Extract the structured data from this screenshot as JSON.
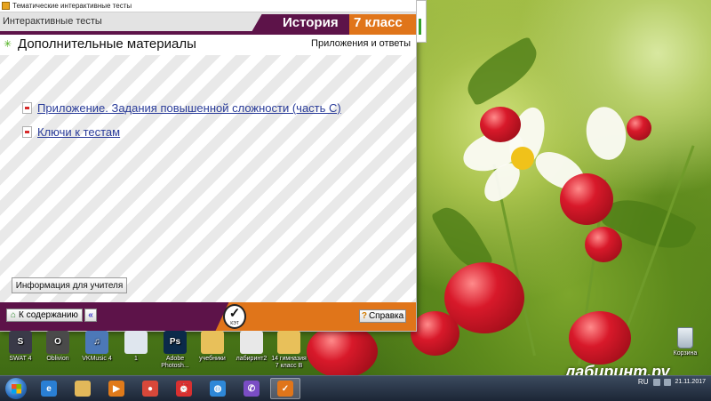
{
  "window": {
    "titlebar": "Тематические интерактивные тесты",
    "app_name": "Интерактивные тесты",
    "subject": "История",
    "grade": "7 класс",
    "section_title": "Дополнительные материалы",
    "section_right": "Приложения и ответы",
    "links": [
      {
        "label": "Приложение. Задания повышенной сложности (часть С)",
        "icon": "pdf-icon"
      },
      {
        "label": "Ключи к тестам",
        "icon": "pdf-icon"
      }
    ],
    "teacher_button": "Информация для учителя",
    "toc_button": "К содержанию",
    "back_button": "«",
    "help_button": "Справка",
    "logo_text": "КЭТ"
  },
  "desktop_icons": [
    {
      "label": "SWAT 4",
      "color": "#3a3a48",
      "glyph": "S"
    },
    {
      "label": "Oblivion",
      "color": "#4a4a4a",
      "glyph": "O"
    },
    {
      "label": "VKMusic 4",
      "color": "#4c78b8",
      "glyph": "♫"
    },
    {
      "label": "1",
      "color": "#dfe6ee",
      "glyph": ""
    },
    {
      "label": "Adobe Photosh...",
      "color": "#0b2a4a",
      "glyph": "Ps"
    },
    {
      "label": "учебники",
      "color": "#e8c05a",
      "glyph": ""
    },
    {
      "label": "лабиринт2",
      "color": "#e8e8e8",
      "glyph": ""
    },
    {
      "label": "14 гимназия 7 класс В",
      "color": "#e8c05a",
      "glyph": ""
    }
  ],
  "recycle_bin": "Корзина",
  "watermark": "лабиринт.ру",
  "taskbar": {
    "apps": [
      {
        "name": "internet-explorer-icon",
        "color": "#2a7fd4",
        "glyph": "e"
      },
      {
        "name": "file-explorer-icon",
        "color": "#e2b85a",
        "glyph": ""
      },
      {
        "name": "media-player-icon",
        "color": "#e07a1a",
        "glyph": "▶"
      },
      {
        "name": "chrome-icon",
        "color": "#d8483a",
        "glyph": "●"
      },
      {
        "name": "alarm-app-icon",
        "color": "#d83030",
        "glyph": "⏰"
      },
      {
        "name": "globe-icon",
        "color": "#2e88d8",
        "glyph": "◍"
      },
      {
        "name": "viber-icon",
        "color": "#7a4dc4",
        "glyph": "✆"
      },
      {
        "name": "tests-app-icon",
        "color": "#e0751a",
        "glyph": "✓"
      }
    ],
    "lang": "RU",
    "date": "21.11.2017"
  }
}
